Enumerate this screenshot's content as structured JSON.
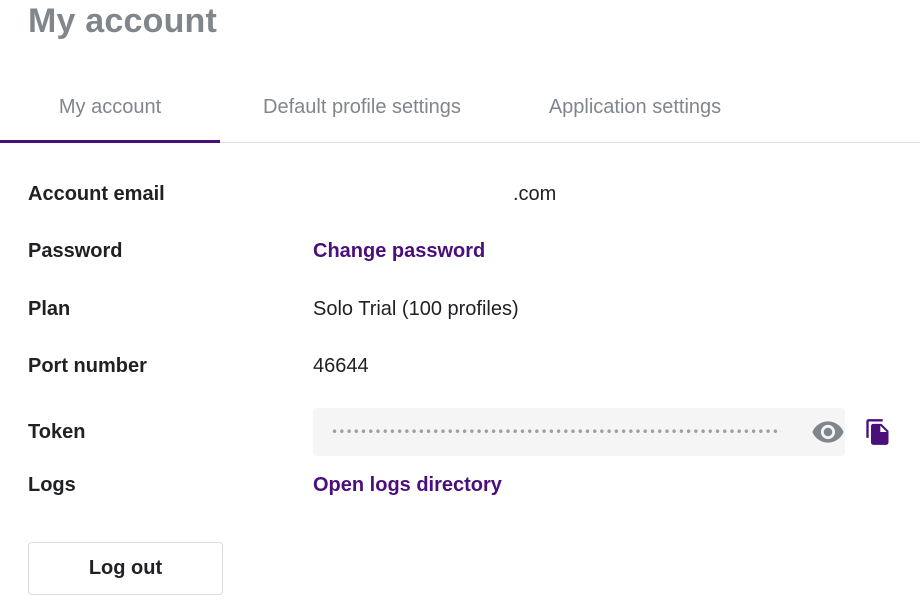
{
  "page": {
    "title": "My account"
  },
  "tabs": [
    {
      "label": "My account",
      "active": true
    },
    {
      "label": "Default profile settings",
      "active": false
    },
    {
      "label": "Application settings",
      "active": false
    }
  ],
  "account": {
    "email_label": "Account email",
    "email_value": ".com",
    "password_label": "Password",
    "password_link": "Change password",
    "plan_label": "Plan",
    "plan_value": "Solo Trial (100 profiles)",
    "port_label": "Port number",
    "port_value": "46644",
    "token_label": "Token",
    "token_masked": "••••••••••••••••••••••••••••••••••••••••••••••••••••••••••••••••••••••••••••••••",
    "logs_label": "Logs",
    "logs_link": "Open logs directory"
  },
  "actions": {
    "logout_label": "Log out"
  },
  "icons": {
    "reveal": "eye-icon",
    "copy": "copy-icon"
  },
  "colors": {
    "accent": "#4a0f7a",
    "muted": "#80868b",
    "icon": "#80868b"
  }
}
